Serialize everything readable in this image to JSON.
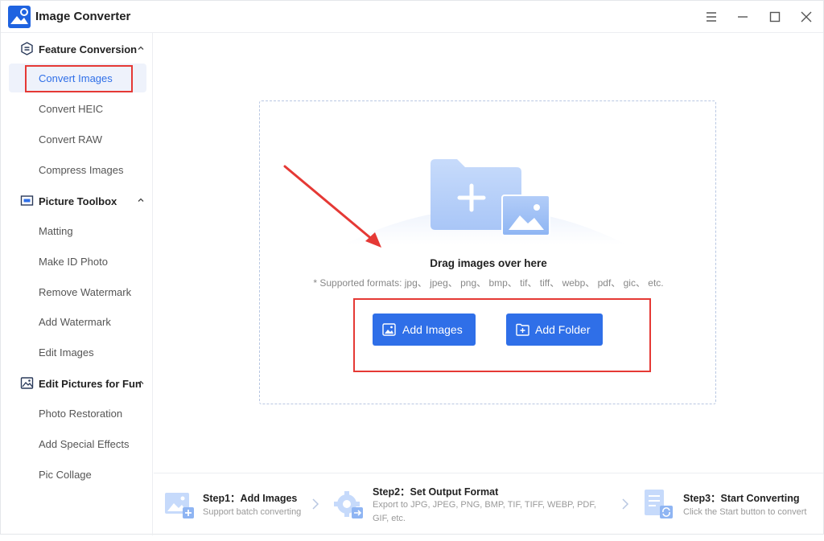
{
  "app": {
    "title": "Image Converter",
    "accent_color": "#2f6fe8",
    "highlight_color": "#e53935"
  },
  "window_controls": [
    "menu-icon",
    "minimize-icon",
    "maximize-icon",
    "close-icon"
  ],
  "sidebar": {
    "groups": [
      {
        "label": "Feature Conversion",
        "icon": "feature-conversion-icon",
        "expanded": true,
        "items": [
          {
            "label": "Convert Images",
            "active": true
          },
          {
            "label": "Convert HEIC"
          },
          {
            "label": "Convert RAW"
          },
          {
            "label": "Compress Images"
          }
        ]
      },
      {
        "label": "Picture Toolbox",
        "icon": "toolbox-icon",
        "expanded": true,
        "items": [
          {
            "label": "Matting"
          },
          {
            "label": "Make ID Photo"
          },
          {
            "label": "Remove Watermark"
          },
          {
            "label": "Add Watermark"
          },
          {
            "label": "Edit Images"
          }
        ]
      },
      {
        "label": "Edit Pictures for Fun",
        "icon": "fun-edit-icon",
        "expanded": true,
        "items": [
          {
            "label": "Photo Restoration"
          },
          {
            "label": "Add Special Effects"
          },
          {
            "label": "Pic Collage"
          }
        ]
      }
    ]
  },
  "dropzone": {
    "title": "Drag images over here",
    "formats": "* Supported formats: jpg、 jpeg、 png、 bmp、 tif、 tiff、 webp、 pdf、 gic、 etc.",
    "add_images_label": "Add Images",
    "add_folder_label": "Add Folder"
  },
  "steps": [
    {
      "title": "Step1：Add Images",
      "desc": "Support batch converting"
    },
    {
      "title": "Step2：Set Output Format",
      "desc": "Export to JPG, JPEG, PNG, BMP, TIF, TIFF, WEBP, PDF, GIF, etc."
    },
    {
      "title": "Step3：Start Converting",
      "desc": "Click the Start button to convert"
    }
  ]
}
